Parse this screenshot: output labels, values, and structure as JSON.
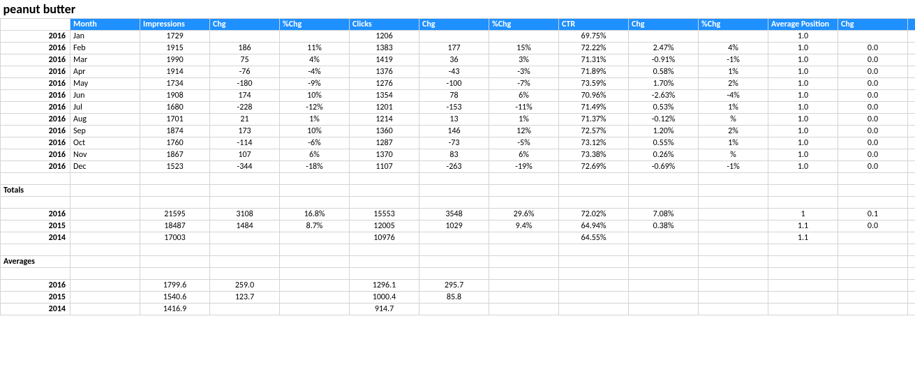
{
  "title": "peanut butter",
  "headers": [
    "Month",
    "Impressions",
    "Chg",
    "%Chg",
    "Clicks",
    "Chg",
    "%Chg",
    "CTR",
    "Chg",
    "%Chg",
    "Average Position",
    "Chg"
  ],
  "rows": [
    {
      "year": "2016",
      "month": "Jan",
      "imp": "1729",
      "impChg": "",
      "impPct": "",
      "clk": "1206",
      "clkChg": "",
      "clkPct": "",
      "ctr": "69.75%",
      "ctrChg": "",
      "ctrPct": "",
      "ap": "1.0",
      "apChg": ""
    },
    {
      "year": "2016",
      "month": "Feb",
      "imp": "1915",
      "impChg": "186",
      "impPct": "11%",
      "clk": "1383",
      "clkChg": "177",
      "clkPct": "15%",
      "ctr": "72.22%",
      "ctrChg": "2.47%",
      "ctrPct": "4%",
      "ap": "1.0",
      "apChg": "0.0"
    },
    {
      "year": "2016",
      "month": "Mar",
      "imp": "1990",
      "impChg": "75",
      "impPct": "4%",
      "clk": "1419",
      "clkChg": "36",
      "clkPct": "3%",
      "ctr": "71.31%",
      "ctrChg": "-0.91%",
      "ctrPct": "-1%",
      "ap": "1.0",
      "apChg": "0.0"
    },
    {
      "year": "2016",
      "month": "Apr",
      "imp": "1914",
      "impChg": "-76",
      "impPct": "-4%",
      "clk": "1376",
      "clkChg": "-43",
      "clkPct": "-3%",
      "ctr": "71.89%",
      "ctrChg": "0.58%",
      "ctrPct": "1%",
      "ap": "1.0",
      "apChg": "0.0"
    },
    {
      "year": "2016",
      "month": "May",
      "imp": "1734",
      "impChg": "-180",
      "impPct": "-9%",
      "clk": "1276",
      "clkChg": "-100",
      "clkPct": "-7%",
      "ctr": "73.59%",
      "ctrChg": "1.70%",
      "ctrPct": "2%",
      "ap": "1.0",
      "apChg": "0.0"
    },
    {
      "year": "2016",
      "month": "Jun",
      "imp": "1908",
      "impChg": "174",
      "impPct": "10%",
      "clk": "1354",
      "clkChg": "78",
      "clkPct": "6%",
      "ctr": "70.96%",
      "ctrChg": "-2.63%",
      "ctrPct": "-4%",
      "ap": "1.0",
      "apChg": "0.0"
    },
    {
      "year": "2016",
      "month": "Jul",
      "imp": "1680",
      "impChg": "-228",
      "impPct": "-12%",
      "clk": "1201",
      "clkChg": "-153",
      "clkPct": "-11%",
      "ctr": "71.49%",
      "ctrChg": "0.53%",
      "ctrPct": "1%",
      "ap": "1.0",
      "apChg": "0.0"
    },
    {
      "year": "2016",
      "month": "Aug",
      "imp": "1701",
      "impChg": "21",
      "impPct": "1%",
      "clk": "1214",
      "clkChg": "13",
      "clkPct": "1%",
      "ctr": "71.37%",
      "ctrChg": "-0.12%",
      "ctrPct": "%",
      "ap": "1.0",
      "apChg": "0.0"
    },
    {
      "year": "2016",
      "month": "Sep",
      "imp": "1874",
      "impChg": "173",
      "impPct": "10%",
      "clk": "1360",
      "clkChg": "146",
      "clkPct": "12%",
      "ctr": "72.57%",
      "ctrChg": "1.20%",
      "ctrPct": "2%",
      "ap": "1.0",
      "apChg": "0.0"
    },
    {
      "year": "2016",
      "month": "Oct",
      "imp": "1760",
      "impChg": "-114",
      "impPct": "-6%",
      "clk": "1287",
      "clkChg": "-73",
      "clkPct": "-5%",
      "ctr": "73.12%",
      "ctrChg": "0.55%",
      "ctrPct": "1%",
      "ap": "1.0",
      "apChg": "0.0"
    },
    {
      "year": "2016",
      "month": "Nov",
      "imp": "1867",
      "impChg": "107",
      "impPct": "6%",
      "clk": "1370",
      "clkChg": "83",
      "clkPct": "6%",
      "ctr": "73.38%",
      "ctrChg": "0.26%",
      "ctrPct": "%",
      "ap": "1.0",
      "apChg": "0.0"
    },
    {
      "year": "2016",
      "month": "Dec",
      "imp": "1523",
      "impChg": "-344",
      "impPct": "-18%",
      "clk": "1107",
      "clkChg": "-263",
      "clkPct": "-19%",
      "ctr": "72.69%",
      "ctrChg": "-0.69%",
      "ctrPct": "-1%",
      "ap": "1.0",
      "apChg": "0.0"
    }
  ],
  "totalsLabel": "Totals",
  "totals": [
    {
      "year": "2016",
      "imp": "21595",
      "impChg": "3108",
      "impPct": "16.8%",
      "clk": "15553",
      "clkChg": "3548",
      "clkPct": "29.6%",
      "ctr": "72.02%",
      "ctrChg": "7.08%",
      "ctrPct": "",
      "ap": "1",
      "apChg": "0.1"
    },
    {
      "year": "2015",
      "imp": "18487",
      "impChg": "1484",
      "impPct": "8.7%",
      "clk": "12005",
      "clkChg": "1029",
      "clkPct": "9.4%",
      "ctr": "64.94%",
      "ctrChg": "0.38%",
      "ctrPct": "",
      "ap": "1.1",
      "apChg": "0.0"
    },
    {
      "year": "2014",
      "imp": "17003",
      "impChg": "",
      "impPct": "",
      "clk": "10976",
      "clkChg": "",
      "clkPct": "",
      "ctr": "64.55%",
      "ctrChg": "",
      "ctrPct": "",
      "ap": "1.1",
      "apChg": ""
    }
  ],
  "averagesLabel": "Averages",
  "averages": [
    {
      "year": "2016",
      "imp": "1799.6",
      "impChg": "259.0",
      "clk": "1296.1",
      "clkChg": "295.7"
    },
    {
      "year": "2015",
      "imp": "1540.6",
      "impChg": "123.7",
      "clk": "1000.4",
      "clkChg": "85.8"
    },
    {
      "year": "2014",
      "imp": "1416.9",
      "impChg": "",
      "clk": "914.7",
      "clkChg": ""
    }
  ]
}
